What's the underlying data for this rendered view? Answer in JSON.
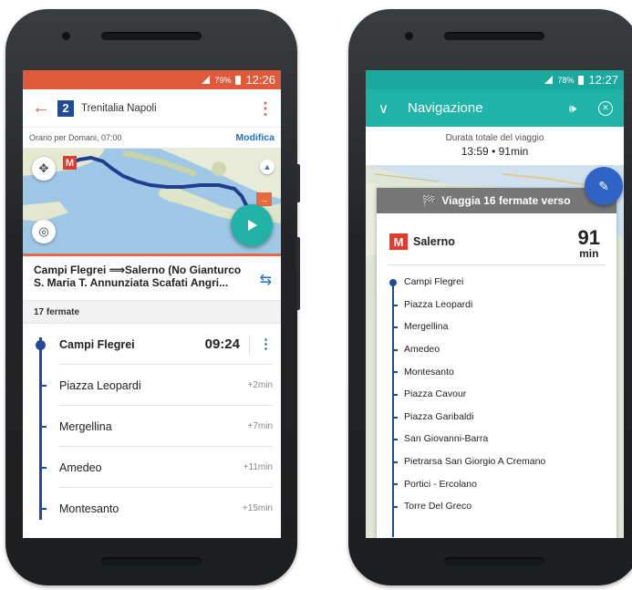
{
  "phone1": {
    "status": {
      "signal_label": "",
      "battery": "79%",
      "time": "12:26"
    },
    "appbar": {
      "line_number": "2",
      "line_name": "Trenitalia Napoli"
    },
    "schedule": {
      "text": "Orario per Domani, 07:00",
      "edit_label": "Modifica"
    },
    "route": {
      "title": "Campi Flegrei ⟹Salerno (No Gianturco S. Maria T. Annunziata Scafati Angri..."
    },
    "stops_count": "17 fermate",
    "stops": [
      {
        "name": "Campi Flegrei",
        "time": "09:24"
      },
      {
        "name": "Piazza Leopardi",
        "time": "+2min"
      },
      {
        "name": "Mergellina",
        "time": "+7min"
      },
      {
        "name": "Amedeo",
        "time": "+11min"
      },
      {
        "name": "Montesanto",
        "time": "+15min"
      }
    ]
  },
  "phone2": {
    "status": {
      "battery": "78%",
      "time": "12:27"
    },
    "appbar": {
      "title": "Navigazione"
    },
    "trip": {
      "label": "Durata totale del viaggio",
      "value": "13:59 • 91min"
    },
    "card": {
      "header": "Viaggia 16 fermate verso",
      "destination": "Salerno",
      "minutes": "91",
      "minutes_unit": "min",
      "stops": [
        "Campi Flegrei",
        "Piazza Leopardi",
        "Mergellina",
        "Amedeo",
        "Montesanto",
        "Piazza Cavour",
        "Piazza Garibaldi",
        "San Giovanni-Barra",
        "Pietrarsa  San Giorgio A Cremano",
        "Portici - Ercolano",
        "Torre Del Greco"
      ]
    }
  },
  "colors": {
    "orange_accent": "#e0633e",
    "teal_accent": "#20b3a8",
    "line_blue": "#1f4b9a",
    "link_blue": "#1e6fbf",
    "metro_red": "#e13b2f"
  }
}
